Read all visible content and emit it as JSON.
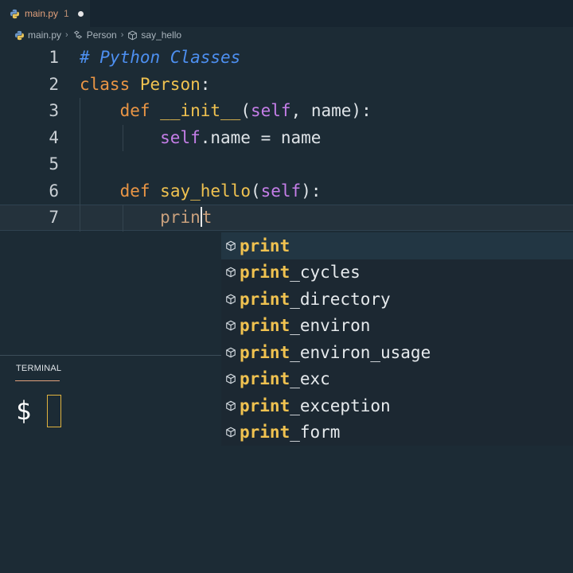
{
  "tab": {
    "filename": "main.py",
    "problem_count": "1"
  },
  "breadcrumb": [
    "main.py",
    "Person",
    "say_hello"
  ],
  "editor": {
    "lines": [
      {
        "n": "1",
        "tokens": [
          {
            "t": "# Python Classes",
            "c": "comment"
          }
        ]
      },
      {
        "n": "2",
        "tokens": [
          {
            "t": "class",
            "c": "kw"
          },
          {
            "t": " ",
            "c": "plain"
          },
          {
            "t": "Person",
            "c": "cls"
          },
          {
            "t": ":",
            "c": "plain"
          }
        ]
      },
      {
        "n": "3",
        "tokens": [
          {
            "t": "    ",
            "c": "plain"
          },
          {
            "t": "def",
            "c": "kw"
          },
          {
            "t": " ",
            "c": "plain"
          },
          {
            "t": "__init__",
            "c": "fn"
          },
          {
            "t": "(",
            "c": "plain"
          },
          {
            "t": "self",
            "c": "self"
          },
          {
            "t": ", name):",
            "c": "plain"
          }
        ]
      },
      {
        "n": "4",
        "tokens": [
          {
            "t": "        ",
            "c": "plain"
          },
          {
            "t": "self",
            "c": "self"
          },
          {
            "t": ".name = name",
            "c": "plain"
          }
        ]
      },
      {
        "n": "5",
        "tokens": []
      },
      {
        "n": "6",
        "tokens": [
          {
            "t": "    ",
            "c": "plain"
          },
          {
            "t": "def",
            "c": "kw"
          },
          {
            "t": " ",
            "c": "plain"
          },
          {
            "t": "say_hello",
            "c": "fn"
          },
          {
            "t": "(",
            "c": "plain"
          },
          {
            "t": "self",
            "c": "self"
          },
          {
            "t": "):",
            "c": "plain"
          }
        ]
      },
      {
        "n": "7",
        "tokens": [
          {
            "t": "        ",
            "c": "plain"
          },
          {
            "t": "prin",
            "c": "typed"
          },
          {
            "t": "|",
            "c": "caret"
          },
          {
            "t": "t",
            "c": "typed"
          }
        ],
        "current": true
      }
    ]
  },
  "suggestions": {
    "match": "print",
    "items": [
      "print",
      "print_cycles",
      "print_directory",
      "print_environ",
      "print_environ_usage",
      "print_exc",
      "print_exception",
      "print_form"
    ],
    "selected_index": 0
  },
  "panel": {
    "tab_label": "TERMINAL",
    "prompt": "$"
  },
  "colors": {
    "background": "#1c2b35",
    "comment": "#4d8ff0",
    "keyword": "#e99545",
    "class_name": "#f0c250",
    "self": "#c57ee8",
    "accent": "#e2a07b"
  }
}
